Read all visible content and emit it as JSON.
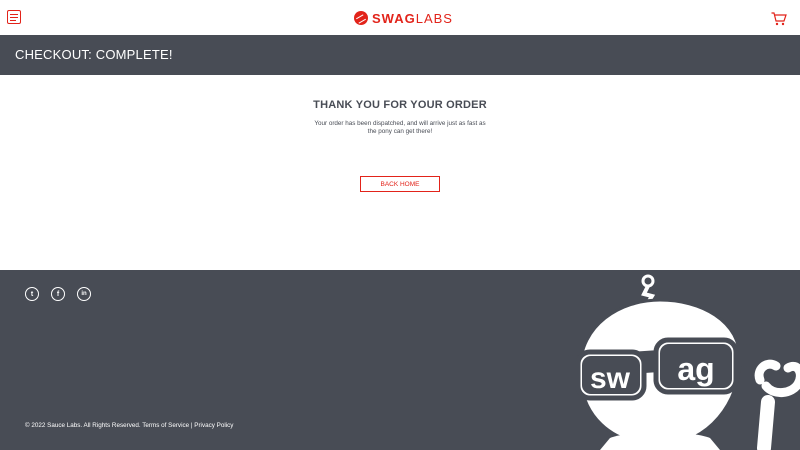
{
  "header": {
    "brand_bold": "SWAG",
    "brand_light": "LABS"
  },
  "subheader": {
    "title": "CHECKOUT: COMPLETE!"
  },
  "main": {
    "heading": "THANK YOU FOR YOUR ORDER",
    "message": "Your order has been dispatched, and will arrive just as fast as the pony can get there!",
    "back_button": "BACK HOME"
  },
  "footer": {
    "social": {
      "twitter_glyph": "t",
      "facebook_glyph": "f",
      "linkedin_glyph": "in"
    },
    "copyright": "© 2022 Sauce Labs. All Rights Reserved. Terms of Service | Privacy Policy",
    "robot_text_left": "sw",
    "robot_text_right": "ag"
  },
  "colors": {
    "accent": "#e2231a",
    "dark": "#484c55",
    "background": "#ffffff"
  },
  "icons": [
    "menu-icon",
    "swag-labs-logo-icon",
    "cart-icon",
    "twitter-icon",
    "facebook-icon",
    "linkedin-icon",
    "swag-bot-mascot"
  ]
}
